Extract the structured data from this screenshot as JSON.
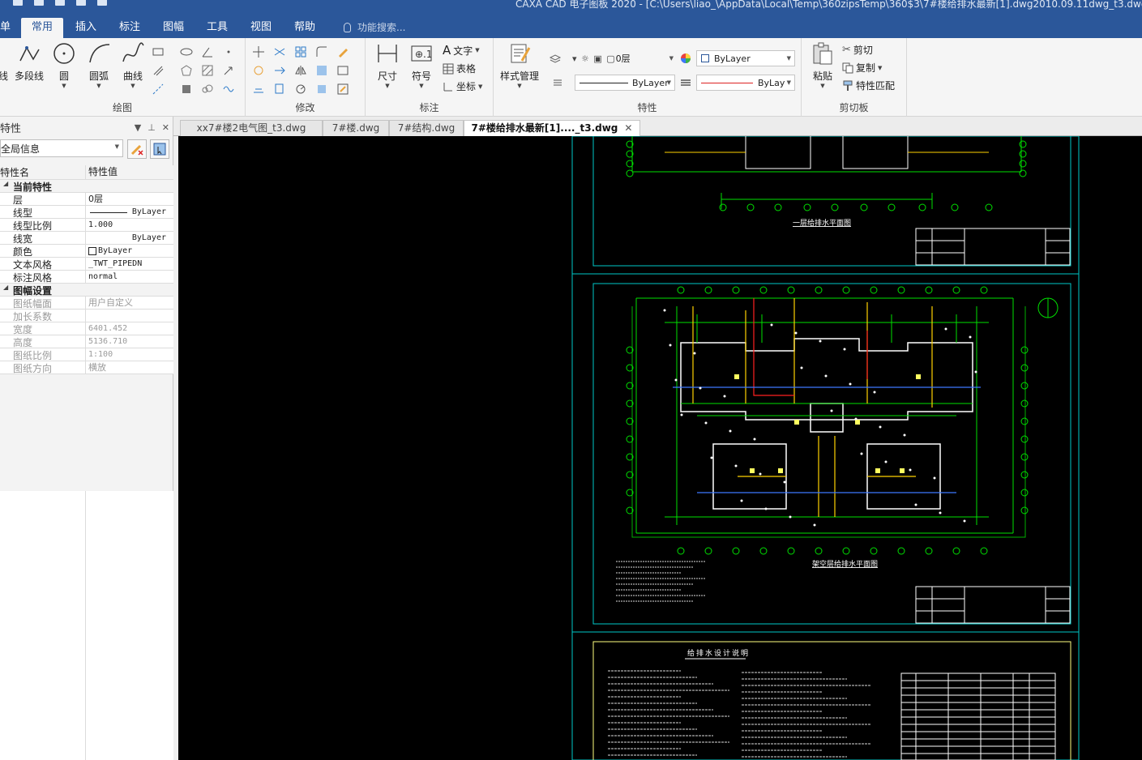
{
  "titlebar": {
    "title": "CAXA CAD 电子图板 2020 - [C:\\Users\\liao_\\AppData\\Local\\Temp\\360zipsTemp\\360$3\\7#楼给排水最新[1].dwg2010.09.11dwg_t3.dwg]"
  },
  "menu": {
    "tabs": [
      {
        "label": "单"
      },
      {
        "label": "常用"
      },
      {
        "label": "插入"
      },
      {
        "label": "标注"
      },
      {
        "label": "图幅"
      },
      {
        "label": "工具"
      },
      {
        "label": "视图"
      },
      {
        "label": "帮助"
      }
    ],
    "search_placeholder": "功能搜索..."
  },
  "ribbon": {
    "draw": {
      "label": "绘图",
      "polyline": "多段线",
      "circle": "圆",
      "arc": "圆弧",
      "curve": "曲线",
      "line_partial": "线"
    },
    "modify": {
      "label": "修改"
    },
    "annotate": {
      "label": "标注",
      "dimension": "尺寸",
      "symbol": "符号",
      "text": "文字",
      "table": "表格",
      "coordinate": "坐标"
    },
    "properties": {
      "label": "特性",
      "style_manager": "样式管理",
      "layer_value": "0层",
      "color_value": "ByLayer",
      "linetype_value": "ByLayer",
      "lineweight_value": "ByLay"
    },
    "clipboard": {
      "label": "剪切板",
      "paste": "粘贴",
      "cut": "剪切",
      "copy": "复制",
      "match": "特性匹配"
    }
  },
  "panel": {
    "title": "特性",
    "selector": "全局信息",
    "col_name": "特性名",
    "col_value": "特性值",
    "sections": [
      {
        "title": "当前特性",
        "rows": [
          {
            "name": "层",
            "value": "0层"
          },
          {
            "name": "线型",
            "value": "ByLayer"
          },
          {
            "name": "线型比例",
            "value": "1.000"
          },
          {
            "name": "线宽",
            "value": "ByLayer"
          },
          {
            "name": "颜色",
            "value": "ByLayer"
          },
          {
            "name": "文本风格",
            "value": "_TWT_PIPEDN"
          },
          {
            "name": "标注风格",
            "value": "normal"
          }
        ]
      },
      {
        "title": "图幅设置",
        "rows": [
          {
            "name": "图纸幅面",
            "value": "用户自定义"
          },
          {
            "name": "加长系数",
            "value": ""
          },
          {
            "name": "宽度",
            "value": "6401.452"
          },
          {
            "name": "高度",
            "value": "5136.710"
          },
          {
            "name": "图纸比例",
            "value": "1:100"
          },
          {
            "name": "图纸方向",
            "value": "横放"
          }
        ]
      }
    ]
  },
  "doc_tabs": [
    {
      "label": "xx7#楼2电气图_t3.dwg"
    },
    {
      "label": "7#楼.dwg"
    },
    {
      "label": "7#结构.dwg"
    },
    {
      "label": "7#楼给排水最新[1]...._t3.dwg"
    }
  ],
  "drawing": {
    "sheet1_caption": "一层给排水平面图",
    "sheet2_caption": "架空层给排水平面图",
    "sheet3_title": "给排水设计说明",
    "colors": {
      "background": "#000000",
      "frame": "#00c8c8",
      "inner_frame": "#ffffff",
      "green": "#00ff00",
      "yellow": "#ffff00",
      "red": "#ff2020",
      "blue": "#3c78ff"
    }
  }
}
